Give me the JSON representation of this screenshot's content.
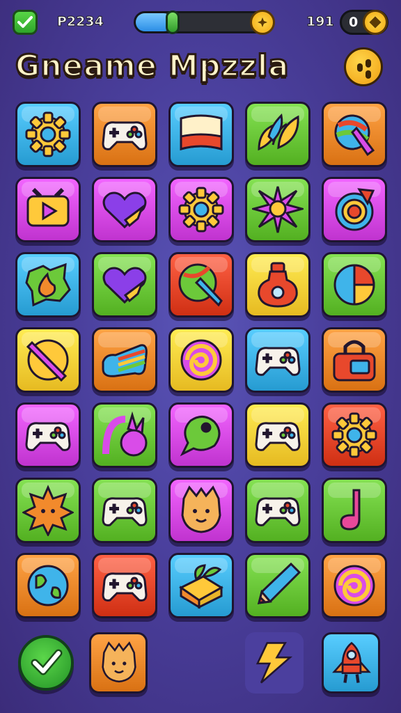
{
  "header": {
    "level_label": "P2234",
    "progress": 0.22,
    "score": "191",
    "coins": "0"
  },
  "title": "Gneame Mpzzla",
  "colors": {
    "cyan": "#3fb4ea",
    "orange": "#f28a2c",
    "green": "#6cc93a",
    "magenta": "#d94ce8",
    "yellow": "#ffd33a",
    "red": "#e8482c"
  },
  "grid": {
    "rows": [
      [
        {
          "bg": "cyan",
          "icon": "gear-icon"
        },
        {
          "bg": "orange",
          "icon": "gamepad-icon"
        },
        {
          "bg": "cyan",
          "icon": "flag-icon"
        },
        {
          "bg": "green",
          "icon": "leaf-icon"
        },
        {
          "bg": "orange",
          "icon": "paint-brush-icon"
        }
      ],
      [
        {
          "bg": "magenta",
          "icon": "play-screen-icon"
        },
        {
          "bg": "magenta",
          "icon": "heart-icon"
        },
        {
          "bg": "magenta",
          "icon": "gear-icon"
        },
        {
          "bg": "green",
          "icon": "star-flower-icon"
        },
        {
          "bg": "magenta",
          "icon": "swirl-arrow-icon"
        }
      ],
      [
        {
          "bg": "cyan",
          "icon": "fire-badge-icon"
        },
        {
          "bg": "green",
          "icon": "heart-icon"
        },
        {
          "bg": "red",
          "icon": "pencil-leaf-icon"
        },
        {
          "bg": "yellow",
          "icon": "potion-icon"
        },
        {
          "bg": "green",
          "icon": "ball-icon"
        }
      ],
      [
        {
          "bg": "yellow",
          "icon": "pencil-ball-icon"
        },
        {
          "bg": "orange",
          "icon": "rainbow-gamepad-icon"
        },
        {
          "bg": "yellow",
          "icon": "swirl-icon"
        },
        {
          "bg": "cyan",
          "icon": "gamepad-icon"
        },
        {
          "bg": "orange",
          "icon": "lock-screen-icon"
        }
      ],
      [
        {
          "bg": "magenta",
          "icon": "gamepad-icon"
        },
        {
          "bg": "green",
          "icon": "bunny-icon"
        },
        {
          "bg": "magenta",
          "icon": "chat-bubble-icon"
        },
        {
          "bg": "yellow",
          "icon": "gamepad-icon"
        },
        {
          "bg": "red",
          "icon": "gear-icon"
        }
      ],
      [
        {
          "bg": "green",
          "icon": "sun-face-icon"
        },
        {
          "bg": "green",
          "icon": "gamepad-icon"
        },
        {
          "bg": "magenta",
          "icon": "cat-face-icon"
        },
        {
          "bg": "green",
          "icon": "gamepad-icon"
        },
        {
          "bg": "green",
          "icon": "music-note-icon"
        }
      ],
      [
        {
          "bg": "orange",
          "icon": "globe-icon"
        },
        {
          "bg": "red",
          "icon": "gamepad-icon"
        },
        {
          "bg": "cyan",
          "icon": "gift-box-icon"
        },
        {
          "bg": "green",
          "icon": "pencil-icon"
        },
        {
          "bg": "orange",
          "icon": "swirl-icon"
        }
      ]
    ]
  },
  "bottom": {
    "check_icon": "checkmark-icon",
    "items": [
      {
        "bg": "orange",
        "icon": "cat-face-icon"
      },
      {
        "bg": "purple",
        "icon": "lightning-icon"
      },
      {
        "bg": "cyan",
        "icon": "rocket-icon"
      }
    ]
  }
}
